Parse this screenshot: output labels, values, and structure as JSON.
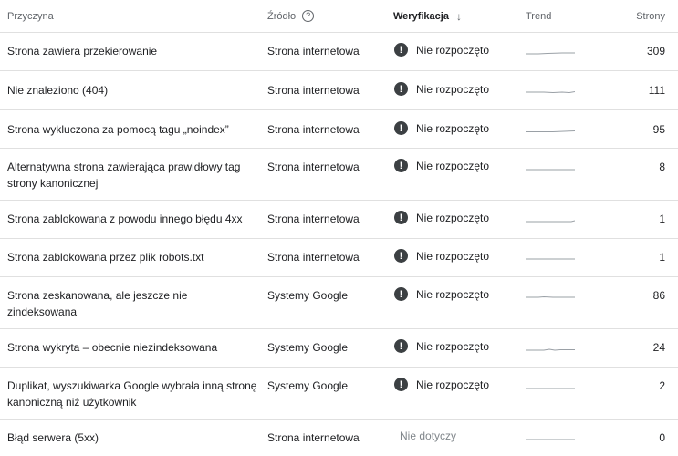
{
  "header": {
    "reason": "Przyczyna",
    "source": "Źródło",
    "verification": "Weryfikacja",
    "trend": "Trend",
    "pages": "Strony"
  },
  "icons": {
    "help": "help-circle-icon",
    "sort": "arrow-down-icon",
    "status": "exclamation-circle-icon"
  },
  "rows": [
    {
      "reason": "Strona zawiera przekierowanie",
      "source": "Strona internetowa",
      "status": "Nie rozpoczęto",
      "pages": "309"
    },
    {
      "reason": "Nie znaleziono (404)",
      "source": "Strona internetowa",
      "status": "Nie rozpoczęto",
      "pages": "111"
    },
    {
      "reason": "Strona wykluczona za pomocą tagu „noindex”",
      "source": "Strona internetowa",
      "status": "Nie rozpoczęto",
      "pages": "95"
    },
    {
      "reason": "Alternatywna strona zawierająca prawidłowy tag strony kanonicznej",
      "source": "Strona internetowa",
      "status": "Nie rozpoczęto",
      "pages": "8"
    },
    {
      "reason": "Strona zablokowana z powodu innego błędu 4xx",
      "source": "Strona internetowa",
      "status": "Nie rozpoczęto",
      "pages": "1"
    },
    {
      "reason": "Strona zablokowana przez plik robots.txt",
      "source": "Strona internetowa",
      "status": "Nie rozpoczęto",
      "pages": "1"
    },
    {
      "reason": "Strona zeskanowana, ale jeszcze nie zindeksowana",
      "source": "Systemy Google",
      "status": "Nie rozpoczęto",
      "pages": "86"
    },
    {
      "reason": "Strona wykryta – obecnie niezindeksowana",
      "source": "Systemy Google",
      "status": "Nie rozpoczęto",
      "pages": "24"
    },
    {
      "reason": "Duplikat, wyszukiwarka Google wybrała inną stronę kanoniczną niż użytkownik",
      "source": "Systemy Google",
      "status": "Nie rozpoczęto",
      "pages": "2"
    },
    {
      "reason": "Błąd serwera (5xx)",
      "source": "Strona internetowa",
      "status": "Nie dotyczy",
      "pages": "0"
    }
  ]
}
